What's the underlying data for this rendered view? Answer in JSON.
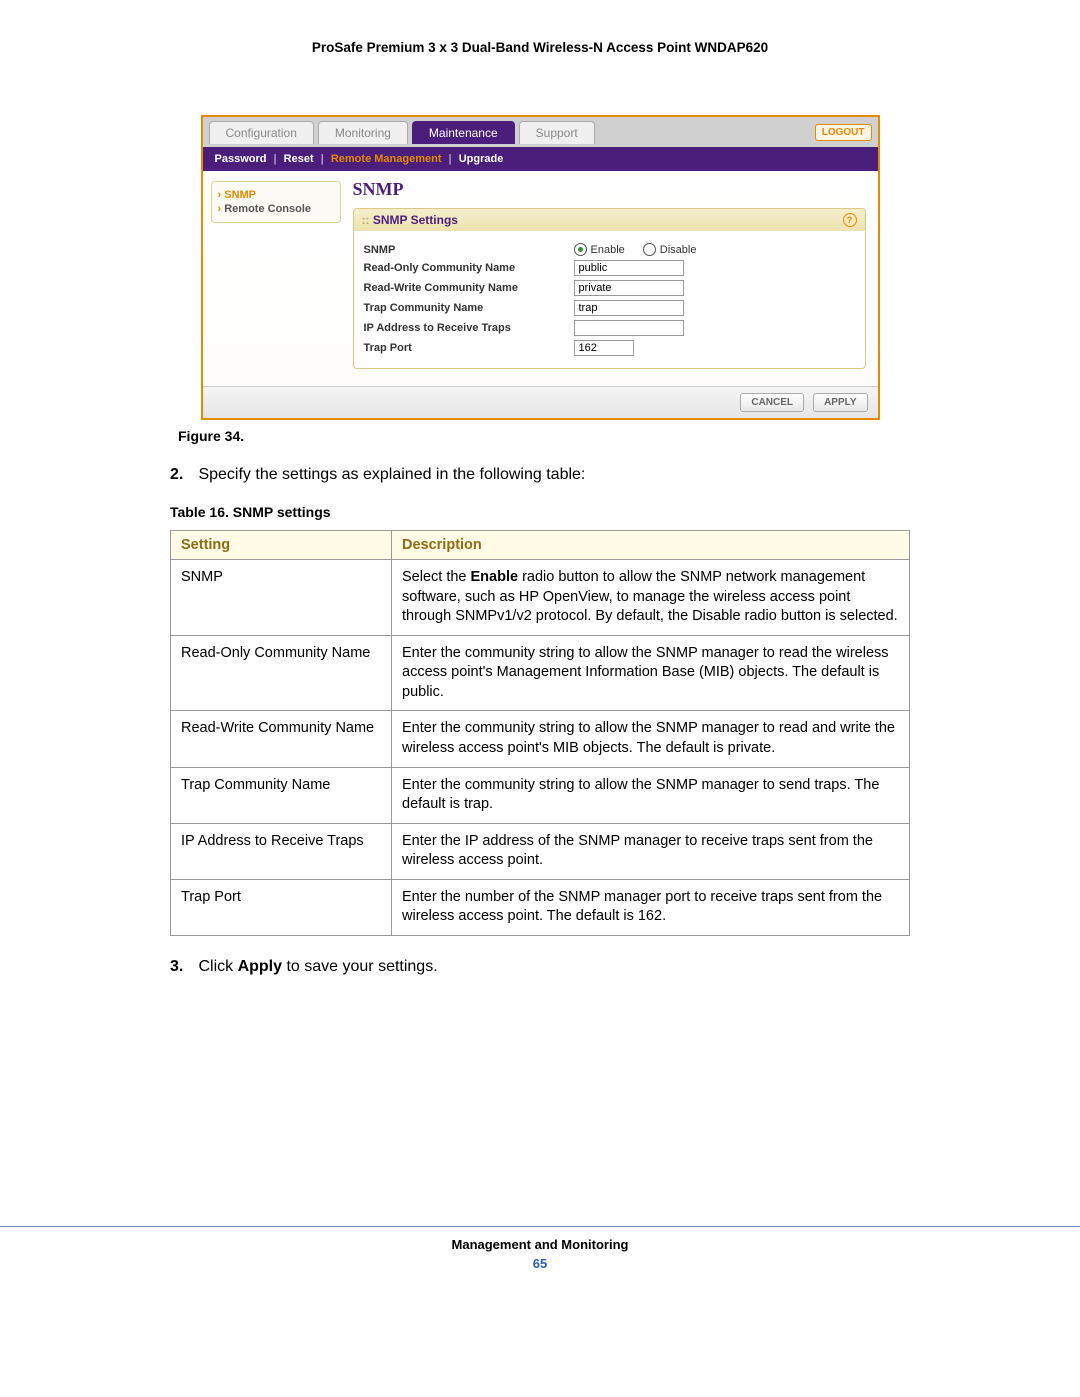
{
  "doc_header": "ProSafe Premium 3 x 3 Dual-Band Wireless-N Access Point WNDAP620",
  "screenshot": {
    "tabs": [
      "Configuration",
      "Monitoring",
      "Maintenance",
      "Support"
    ],
    "active_tab_index": 2,
    "logout": "LOGOUT",
    "subnav_items": [
      "Password",
      "Reset",
      "Remote Management",
      "Upgrade"
    ],
    "subnav_active_index": 2,
    "sidebar": [
      "SNMP",
      "Remote Console"
    ],
    "sidebar_active_index": 0,
    "panel_title_big": "SNMP",
    "panel_head": "SNMP Settings",
    "rows": [
      {
        "label": "SNMP",
        "type": "radio",
        "options": [
          "Enable",
          "Disable"
        ],
        "selected": 0
      },
      {
        "label": "Read-Only Community Name",
        "type": "text",
        "value": "public"
      },
      {
        "label": "Read-Write Community Name",
        "type": "text",
        "value": "private"
      },
      {
        "label": "Trap Community Name",
        "type": "text",
        "value": "trap"
      },
      {
        "label": "IP Address to Receive Traps",
        "type": "text",
        "value": ""
      },
      {
        "label": "Trap Port",
        "type": "text",
        "value": "162"
      }
    ],
    "buttons": {
      "cancel": "CANCEL",
      "apply": "APPLY"
    }
  },
  "figure_caption": "Figure 34.",
  "step2_num": "2.",
  "step2_text": "Specify the settings as explained in the following table:",
  "table_caption": "Table 16.  SNMP settings",
  "table_headers": [
    "Setting",
    "Description"
  ],
  "table_rows": [
    {
      "setting": "SNMP",
      "desc_parts": [
        "Select the ",
        "Enable",
        " radio button to allow the SNMP network management software, such as HP OpenView, to manage the wireless access point through SNMPv1/v2 protocol. By default, the Disable radio button is selected."
      ],
      "bold_index": 1
    },
    {
      "setting": "Read-Only Community Name",
      "desc": "Enter the community string to allow the SNMP manager to read the wireless access point's Management Information Base (MIB) objects. The default is public."
    },
    {
      "setting": "Read-Write Community Name",
      "desc": "Enter the community string to allow the SNMP manager to read and write the wireless access point's MIB objects. The default is private."
    },
    {
      "setting": "Trap Community Name",
      "desc": "Enter the community string to allow the SNMP manager to send traps. The default is trap."
    },
    {
      "setting": "IP Address to Receive Traps",
      "desc": "Enter the IP address of the SNMP manager to receive traps sent from the wireless access point."
    },
    {
      "setting": "Trap Port",
      "desc": "Enter the number of the SNMP manager port to receive traps sent from the wireless access point. The default is 162."
    }
  ],
  "step3_num": "3.",
  "step3_pre": "Click ",
  "step3_bold": "Apply",
  "step3_post": " to save your settings.",
  "footer_title": "Management and Monitoring",
  "footer_page": "65"
}
